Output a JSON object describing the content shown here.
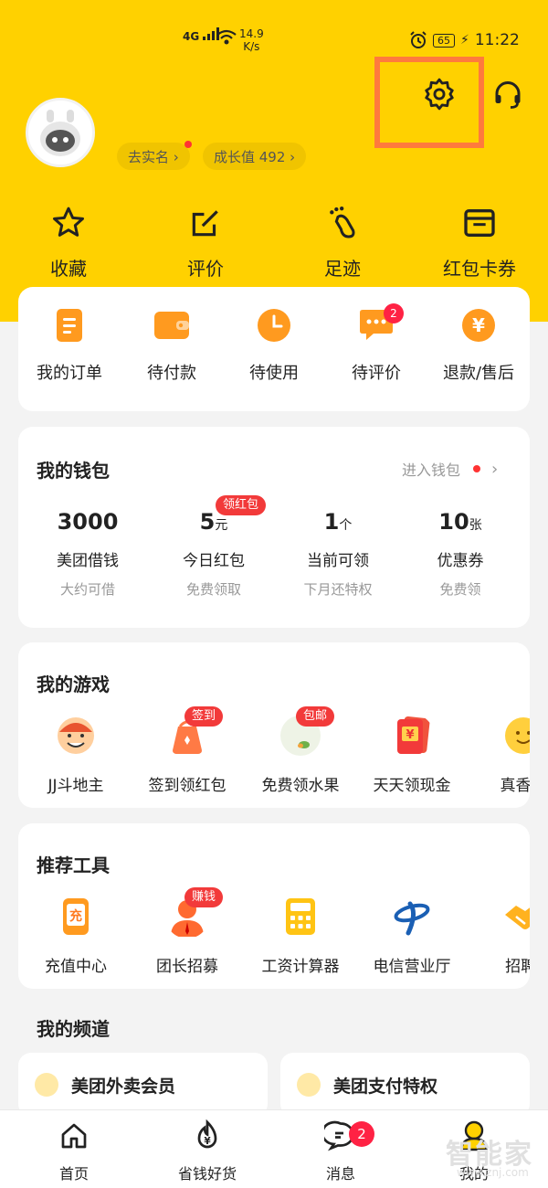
{
  "status_bar": {
    "network": "4G",
    "speed": "14.9",
    "speed_unit": "K/s",
    "battery": "65",
    "time": "11:22"
  },
  "header": {
    "verify_label": "去实名 ›",
    "growth_label": "成长值 492 ›"
  },
  "quick": [
    {
      "label": "收藏",
      "icon": "star-icon"
    },
    {
      "label": "评价",
      "icon": "edit-icon"
    },
    {
      "label": "足迹",
      "icon": "footprint-icon"
    },
    {
      "label": "红包卡券",
      "icon": "coupon-wallet-icon"
    }
  ],
  "orders": [
    {
      "label": "我的订单",
      "icon": "order-list-icon"
    },
    {
      "label": "待付款",
      "icon": "wallet-icon"
    },
    {
      "label": "待使用",
      "icon": "clock-icon"
    },
    {
      "label": "待评价",
      "icon": "comment-icon",
      "badge": "2"
    },
    {
      "label": "退款/售后",
      "icon": "refund-icon"
    }
  ],
  "wallet": {
    "title": "我的钱包",
    "enter_label": "进入钱包",
    "tag": "领红包",
    "items": [
      {
        "value": "3000",
        "unit": "",
        "label": "美团借钱",
        "sub": "大约可借"
      },
      {
        "value": "5",
        "unit": "元",
        "label": "今日红包",
        "sub": "免费领取"
      },
      {
        "value": "1",
        "unit": "个",
        "label": "当前可领",
        "sub": "下月还特权"
      },
      {
        "value": "10",
        "unit": "张",
        "label": "优惠券",
        "sub": "免费领"
      }
    ]
  },
  "games": {
    "title": "我的游戏",
    "items": [
      {
        "label": "JJ斗地主",
        "icon": "landlord-game-icon"
      },
      {
        "label": "签到领红包",
        "icon": "lucky-bag-icon",
        "tag": "签到"
      },
      {
        "label": "免费领水果",
        "icon": "fruit-icon",
        "tag": "包邮"
      },
      {
        "label": "天天领现金",
        "icon": "red-envelope-icon"
      },
      {
        "label": "真香大",
        "icon": "smiley-icon"
      }
    ]
  },
  "tools": {
    "title": "推荐工具",
    "items": [
      {
        "label": "充值中心",
        "icon": "phone-recharge-icon"
      },
      {
        "label": "团长招募",
        "icon": "leader-icon",
        "tag": "赚钱"
      },
      {
        "label": "工资计算器",
        "icon": "calculator-icon"
      },
      {
        "label": "电信营业厅",
        "icon": "telecom-icon"
      },
      {
        "label": "招聘/",
        "icon": "handshake-icon"
      }
    ]
  },
  "channels": {
    "title": "我的频道",
    "items": [
      {
        "label": "美团外卖会员"
      },
      {
        "label": "美团支付特权"
      }
    ]
  },
  "bottom_nav": [
    {
      "label": "首页"
    },
    {
      "label": "省钱好货"
    },
    {
      "label": "消息",
      "badge": "2"
    },
    {
      "label": "我的"
    }
  ],
  "watermark": {
    "text": "智能家",
    "url": "www.znj.com"
  },
  "colors": {
    "brand_yellow": "#ffd100",
    "accent_orange": "#ff9a1f",
    "badge_red": "#f23a3a",
    "highlight": "#ff7a3d"
  }
}
